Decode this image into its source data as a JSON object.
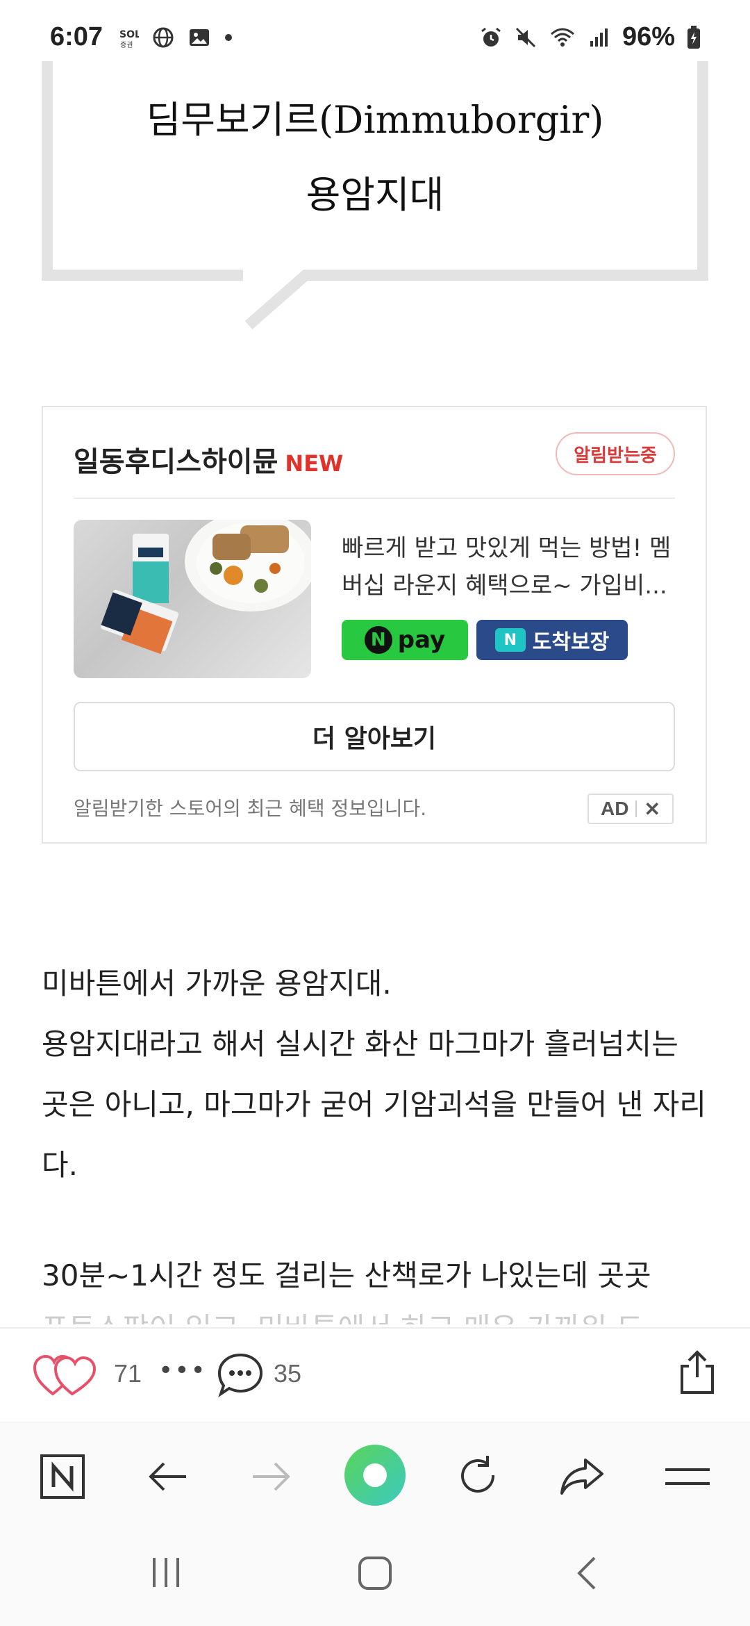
{
  "status_bar": {
    "time": "6:07",
    "battery": "96%",
    "left_icons": [
      "sol-icon",
      "globe-icon",
      "image-icon",
      "dot-icon"
    ],
    "right_icons": [
      "alarm-icon",
      "mute-icon",
      "wifi-icon",
      "signal-icon",
      "battery-icon"
    ]
  },
  "quote": {
    "line1": "딤무보기르(Dimmuborgir)",
    "line2": "용암지대"
  },
  "ad": {
    "store_name": "일동후디스하이뮨",
    "new_label": "NEW",
    "subscribe_pill": "알림받는중",
    "description": "빠르게 받고 맛있게 먹는 방법! 멤버십 라운지 혜택으로~ 가입비...",
    "npay_label": "pay",
    "npay_n": "N",
    "arrival_n": "N",
    "arrival_label": "도착보장",
    "more_button": "더 알아보기",
    "footnote": "알림받기한 스토어의 최근 혜택 정보입니다.",
    "ad_label": "AD",
    "close_label": "✕"
  },
  "article": {
    "line1": "미바튼에서 가까운 용암지대.",
    "line2": "용암지대라고 해서 실시간 화산 마그마가 흘러넘치는 곳은 아니고, 마그마가 굳어 기암괴석을 만들어 낸 자리다.",
    "para2": "30분~1시간 정도 걸리는 산책로가 나있는데 곳곳",
    "para2_cut": "포토스팟이 있고, 미바튼에서 하고 매우 가까워 드"
  },
  "reactions": {
    "likes": "71",
    "more": "•••",
    "comments": "35"
  },
  "colors": {
    "accent_red": "#e0322b",
    "npay_green": "#28c840",
    "arrival_blue": "#2b4a89",
    "heart_pink": "#e8506a"
  }
}
